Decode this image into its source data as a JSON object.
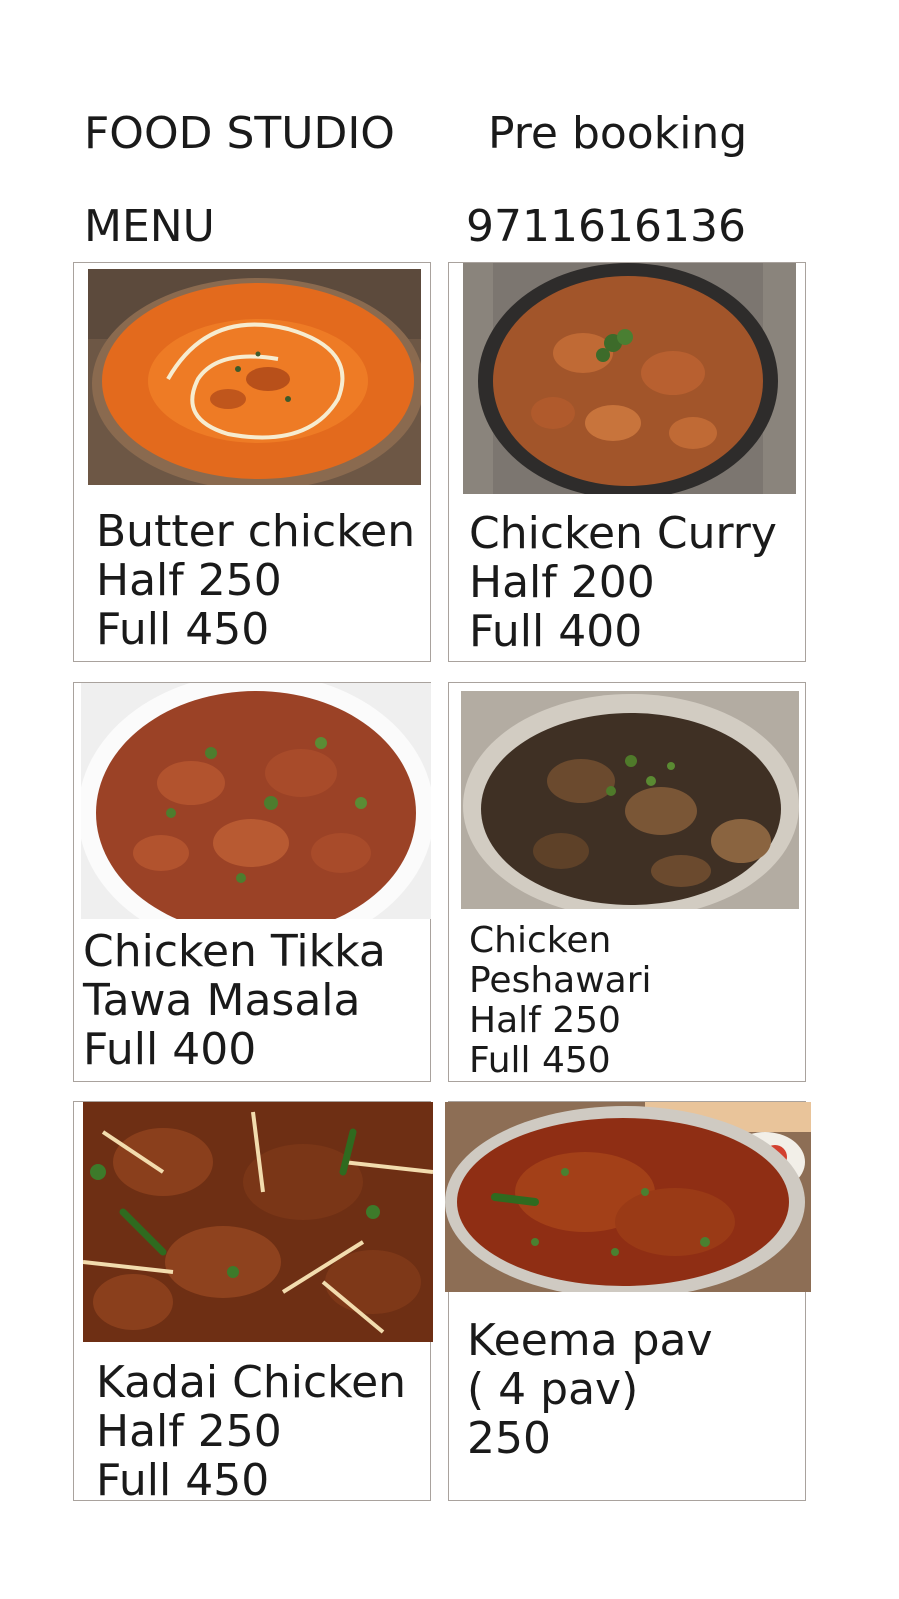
{
  "header": {
    "brand": "FOOD STUDIO",
    "menu": "MENU",
    "prebooking": "Pre booking",
    "phone": "9711616136"
  },
  "items": [
    {
      "name": "Butter chicken",
      "line2": "Half 250",
      "line3": "Full 450",
      "photo": "butter-chicken-photo"
    },
    {
      "name": "Chicken Curry",
      "line2": "Half 200",
      "line3": "Full 400",
      "photo": "chicken-curry-photo"
    },
    {
      "name": "Chicken Tikka",
      "line2": "Tawa Masala",
      "line3": "Full 400",
      "photo": "chicken-tikka-photo"
    },
    {
      "name": "Chicken",
      "line2": "Peshawari",
      "line3": "Half 250",
      "line4": "Full 450",
      "photo": "chicken-peshawari-photo"
    },
    {
      "name": "Kadai Chicken",
      "line2": "Half 250",
      "line3": "Full 450",
      "photo": "kadai-chicken-photo"
    },
    {
      "name": "Keema pav",
      "line2": "( 4 pav)",
      "line3": "250",
      "photo": "keema-pav-photo"
    }
  ]
}
